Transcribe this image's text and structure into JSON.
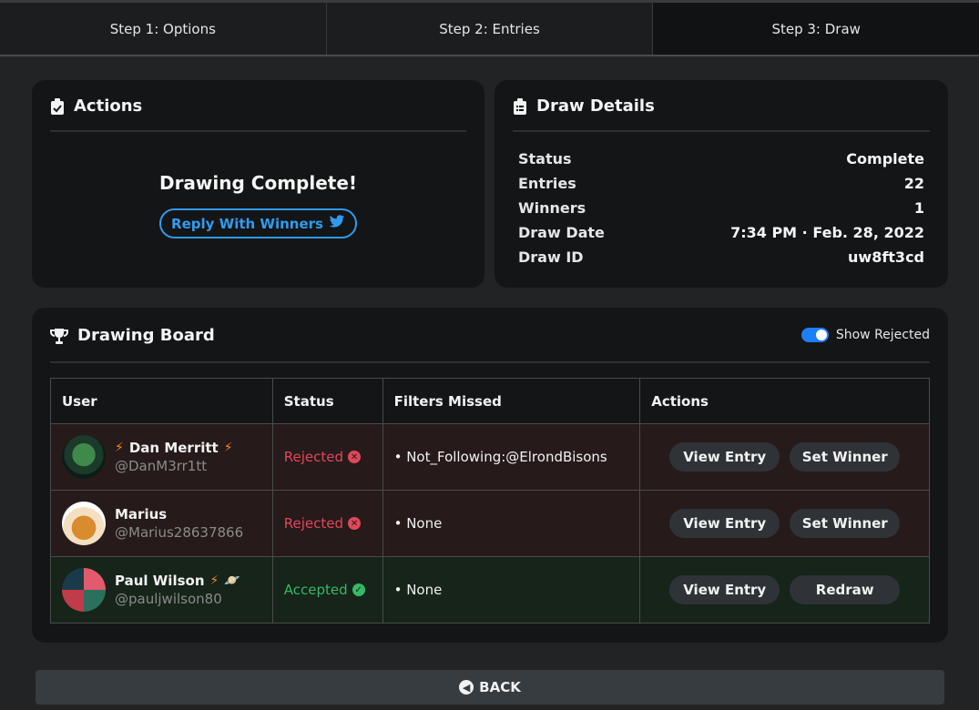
{
  "tabs": [
    {
      "label": "Step 1: Options"
    },
    {
      "label": "Step 2: Entries"
    },
    {
      "label": "Step 3: Draw"
    }
  ],
  "actions": {
    "title": "Actions",
    "complete_text": "Drawing Complete!",
    "reply_label": "Reply With Winners"
  },
  "details": {
    "title": "Draw Details",
    "rows": [
      {
        "key": "Status",
        "value": "Complete"
      },
      {
        "key": "Entries",
        "value": "22"
      },
      {
        "key": "Winners",
        "value": "1"
      },
      {
        "key": "Draw Date",
        "value": "7:34 PM · Feb. 28, 2022"
      },
      {
        "key": "Draw ID",
        "value": "uw8ft3cd"
      }
    ]
  },
  "board": {
    "title": "Drawing Board",
    "toggle_label": "Show Rejected",
    "toggle_on": true,
    "columns": [
      "User",
      "Status",
      "Filters Missed",
      "Actions"
    ],
    "rows": [
      {
        "name": "Dan Merritt",
        "handle": "@DanM3rr1tt",
        "status": "Rejected",
        "filters": "• Not_Following:@ElrondBisons",
        "action1": "View Entry",
        "action2": "Set Winner"
      },
      {
        "name": "Marius",
        "handle": "@Marius28637866",
        "status": "Rejected",
        "filters": "• None",
        "action1": "View Entry",
        "action2": "Set Winner"
      },
      {
        "name": "Paul Wilson",
        "handle": "@pauljwilson80",
        "status": "Accepted",
        "filters": "• None",
        "action1": "View Entry",
        "action2": "Redraw"
      }
    ]
  },
  "back_label": "BACK",
  "colors": {
    "accent_blue": "#2f9bf0",
    "rejected": "#e0485a",
    "accepted": "#36b866",
    "toggle": "#1f7ef5"
  }
}
